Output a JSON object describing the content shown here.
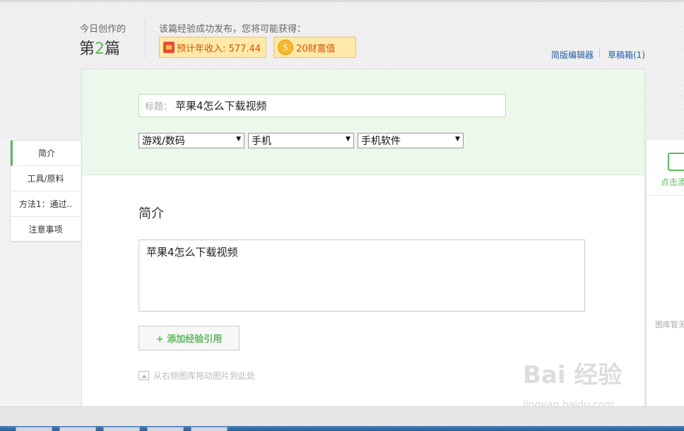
{
  "header": {
    "today_label": "今日创作的",
    "today_count_prefix": "第",
    "today_count_num": "2",
    "today_count_suffix": "篇",
    "reward_label": "该篇经验成功发布，您将可能获得：",
    "income_label": "预计年收入: 577.44",
    "wealth_label": "20财富值",
    "link_simple_editor": "简版编辑器",
    "link_drafts": "草稿箱(1)"
  },
  "form": {
    "title_prefix": "标题：",
    "title_value": "苹果4怎么下载视频",
    "category1": "游戏/数码",
    "category2": "手机",
    "category3": "手机软件",
    "intro_heading": "简介",
    "intro_value": "苹果4怎么下载视频",
    "add_ref_label": "+ 添加经验引用",
    "drag_hint": "从右侧图库拖动图片到此处"
  },
  "sidebar": {
    "items": [
      {
        "label": "简介",
        "active": true
      },
      {
        "label": "工具/原料"
      },
      {
        "label": "方法1：通过.."
      },
      {
        "label": "注意事项"
      }
    ]
  },
  "gallery": {
    "add_label": "点击添",
    "empty_label": "图库暂无"
  },
  "watermark": {
    "main": "Bai 经验",
    "sub": "jingyan.baidu.com"
  },
  "colors": {
    "accent_green": "#5cb85c",
    "badge_bg": "#ffe9a8",
    "top_panel_bg": "#edf8ec"
  }
}
